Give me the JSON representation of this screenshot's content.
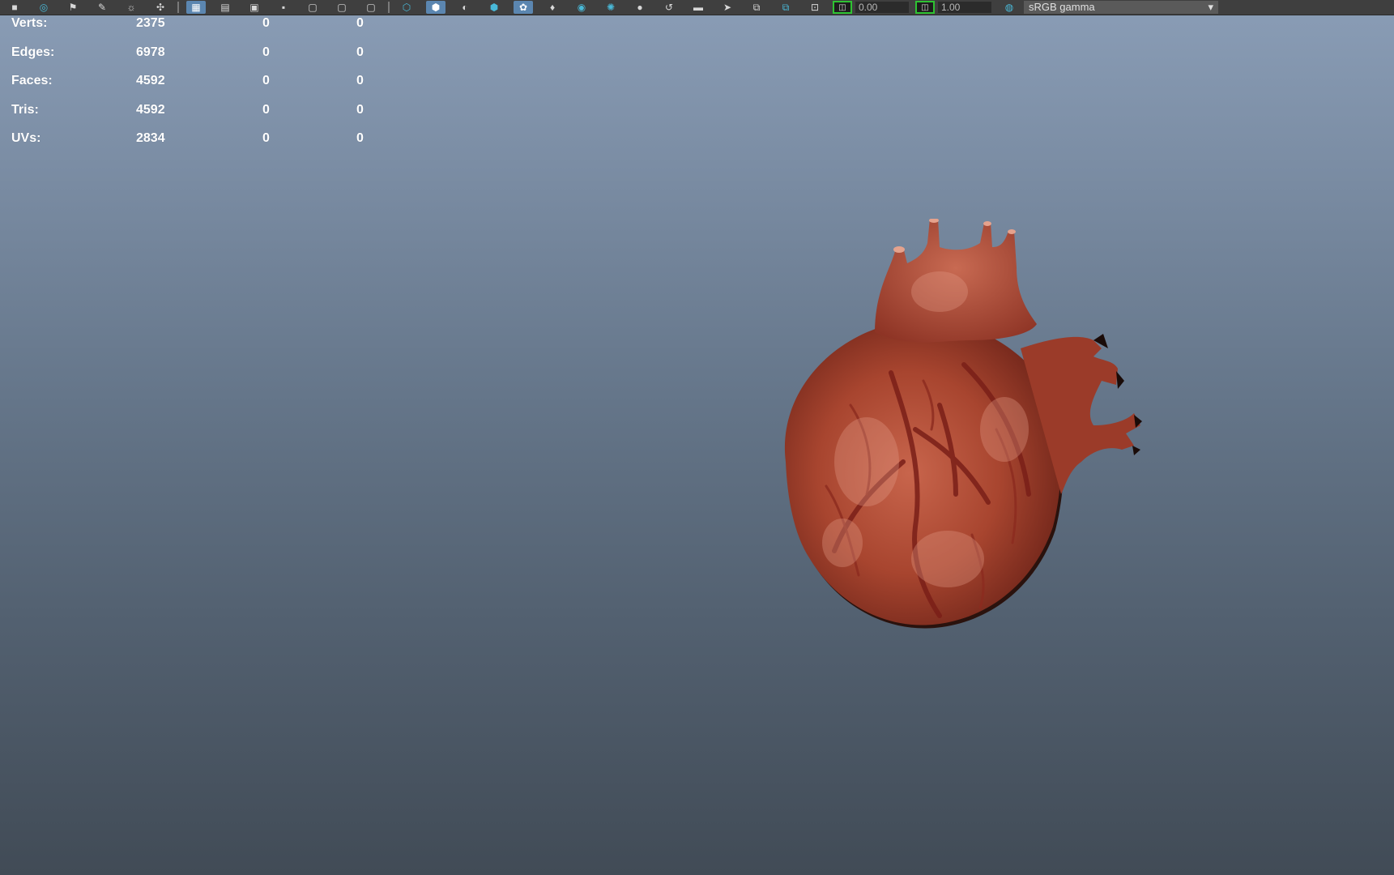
{
  "toolbar": {
    "icons": [
      "camera-icon",
      "bookmark-icon",
      "pencil-icon",
      "paint-icon",
      "grid-icon",
      "film-gate-icon",
      "resolution-gate-icon",
      "field-chart-icon",
      "safe-action-icon",
      "safe-title-icon",
      "wireframe-icon",
      "smooth-shade-icon",
      "xray-icon",
      "texture-icon",
      "shadow-icon",
      "light-icon",
      "isolate-icon",
      "joint-icon",
      "manipulator-icon",
      "snapshot-icon",
      "layout-icon",
      "two-pane-icon",
      "four-pane-icon"
    ],
    "exposure_value": "0.00",
    "gamma_value": "1.00",
    "color_management": "sRGB gamma"
  },
  "hud": {
    "rows": [
      {
        "label": "Verts:",
        "value": "2375",
        "sel1": "0",
        "sel2": "0"
      },
      {
        "label": "Edges:",
        "value": "6978",
        "sel1": "0",
        "sel2": "0"
      },
      {
        "label": "Faces:",
        "value": "4592",
        "sel1": "0",
        "sel2": "0"
      },
      {
        "label": "Tris:",
        "value": "4592",
        "sel1": "0",
        "sel2": "0"
      },
      {
        "label": "UVs:",
        "value": "2834",
        "sel1": "0",
        "sel2": "0"
      }
    ]
  },
  "viewport": {
    "model": "heart-model",
    "colors": {
      "tissue": "#a8452f",
      "vessel": "#7a1f18",
      "highlight": "#e29b86",
      "background_top": "#8a9db6",
      "background_bottom": "#414b56"
    }
  }
}
